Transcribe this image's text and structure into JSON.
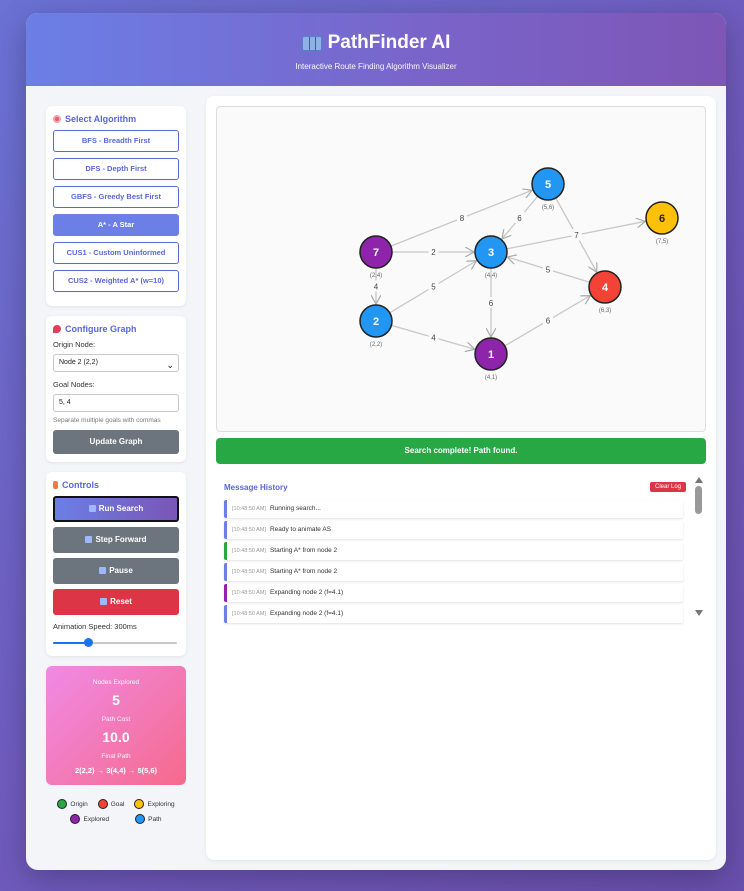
{
  "header": {
    "title": "PathFinder AI",
    "subtitle": "Interactive Route Finding Algorithm Visualizer"
  },
  "algorithm": {
    "title": "Select Algorithm",
    "buttons": [
      {
        "label": "BFS - Breadth First",
        "active": false
      },
      {
        "label": "DFS - Depth First",
        "active": false
      },
      {
        "label": "GBFS - Greedy Best First",
        "active": false
      },
      {
        "label": "A* - A Star",
        "active": true
      },
      {
        "label": "CUS1 - Custom Uninformed",
        "active": false
      },
      {
        "label": "CUS2 - Weighted A* (w=10)",
        "active": false
      }
    ]
  },
  "configure": {
    "title": "Configure Graph",
    "origin_label": "Origin Node:",
    "origin_value": "Node 2 (2,2)",
    "goal_label": "Goal Nodes:",
    "goal_value": "5, 4",
    "hint": "Separate multiple goals with commas",
    "update_label": "Update Graph"
  },
  "controls": {
    "title": "Controls",
    "run_label": "Run Search",
    "step_label": "Step Forward",
    "pause_label": "Pause",
    "reset_label": "Reset",
    "speed_label": "Animation Speed: 300ms",
    "speed_level": 0.28
  },
  "stats": {
    "nodes_label": "Nodes Explored",
    "nodes_value": "5",
    "cost_label": "Path Cost",
    "cost_value": "10.0",
    "path_label": "Final Path",
    "path_value": "2(2,2) → 3(4,4) → 5(5,6)"
  },
  "legend": {
    "origin": "Origin",
    "goal": "Goal",
    "exploring": "Exploring",
    "explored": "Explored",
    "path": "Path"
  },
  "graph": {
    "nodes": [
      {
        "id": "1",
        "coord": "(4,1)",
        "state": "explored"
      },
      {
        "id": "2",
        "coord": "(2,2)",
        "state": "path"
      },
      {
        "id": "3",
        "coord": "(4,4)",
        "state": "path"
      },
      {
        "id": "4",
        "coord": "(6,3)",
        "state": "goal"
      },
      {
        "id": "5",
        "coord": "(5,6)",
        "state": "path"
      },
      {
        "id": "6",
        "coord": "(7,5)",
        "state": "exploring"
      },
      {
        "id": "7",
        "coord": "(2,4)",
        "state": "explored"
      }
    ],
    "edges": [
      {
        "from": "7",
        "to": "5",
        "weight": "8"
      },
      {
        "from": "7",
        "to": "3",
        "weight": "2"
      },
      {
        "from": "7",
        "to": "2",
        "weight": "4"
      },
      {
        "from": "2",
        "to": "3",
        "weight": "5"
      },
      {
        "from": "2",
        "to": "1",
        "weight": "4"
      },
      {
        "from": "3",
        "to": "1",
        "weight": "6"
      },
      {
        "from": "5",
        "to": "3",
        "weight": "6"
      },
      {
        "from": "5",
        "to": "4",
        "weight": "7"
      },
      {
        "from": "4",
        "to": "3",
        "weight": "5"
      },
      {
        "from": "1",
        "to": "4",
        "weight": "6"
      },
      {
        "from": "3",
        "to": "6",
        "weight": "7"
      }
    ]
  },
  "colors": {
    "origin": "#28a745",
    "goal": "#f44336",
    "exploring": "#ffc107",
    "explored": "#8e24aa",
    "path": "#2196f3",
    "accent": "#5a67d8"
  },
  "status": "Search complete! Path found.",
  "history": {
    "title": "Message History",
    "clear_label": "Clear Log",
    "entries": [
      {
        "time": "[10:48:50 AM]",
        "text": "Running search...",
        "color": "#6b7fe6"
      },
      {
        "time": "[10:48:50 AM]",
        "text": "Ready to animate AS",
        "color": "#6b7fe6"
      },
      {
        "time": "[10:48:50 AM]",
        "text": "Starting A* from node 2",
        "color": "#28a745"
      },
      {
        "time": "[10:48:50 AM]",
        "text": "Starting A* from node 2",
        "color": "#6b7fe6"
      },
      {
        "time": "[10:48:50 AM]",
        "text": "Expanding node 2 (f=4.1)",
        "color": "#8e24aa"
      },
      {
        "time": "[10:48:50 AM]",
        "text": "Expanding node 2 (f=4.1)",
        "color": "#6b7fe6"
      }
    ]
  }
}
